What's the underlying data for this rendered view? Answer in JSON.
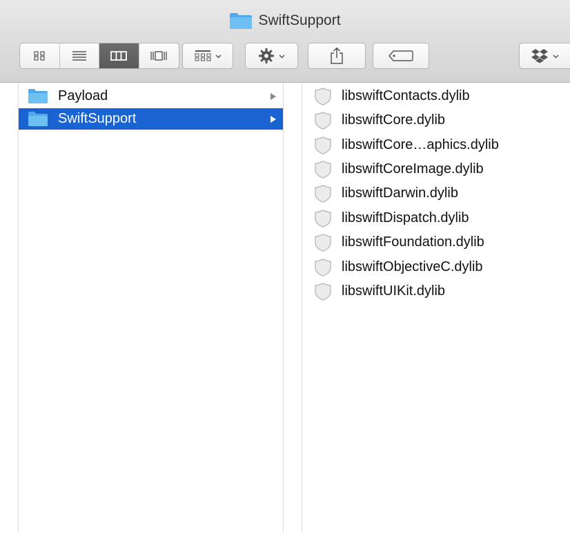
{
  "window": {
    "title": "SwiftSupport"
  },
  "toolbar": {
    "view_modes": [
      "icon-view",
      "list-view",
      "column-view",
      "cover-flow-view"
    ],
    "active_view": "column-view"
  },
  "sidebar": {
    "items": [
      {
        "label": "Payload",
        "selected": false
      },
      {
        "label": "SwiftSupport",
        "selected": true
      }
    ]
  },
  "files": [
    {
      "name": "libswiftContacts.dylib"
    },
    {
      "name": "libswiftCore.dylib"
    },
    {
      "name": "libswiftCore…aphics.dylib"
    },
    {
      "name": "libswiftCoreImage.dylib"
    },
    {
      "name": "libswiftDarwin.dylib"
    },
    {
      "name": "libswiftDispatch.dylib"
    },
    {
      "name": "libswiftFoundation.dylib"
    },
    {
      "name": "libswiftObjectiveC.dylib"
    },
    {
      "name": "libswiftUIKit.dylib"
    }
  ],
  "colors": {
    "selection": "#1a63d2",
    "folder": "#5fb2ee"
  }
}
